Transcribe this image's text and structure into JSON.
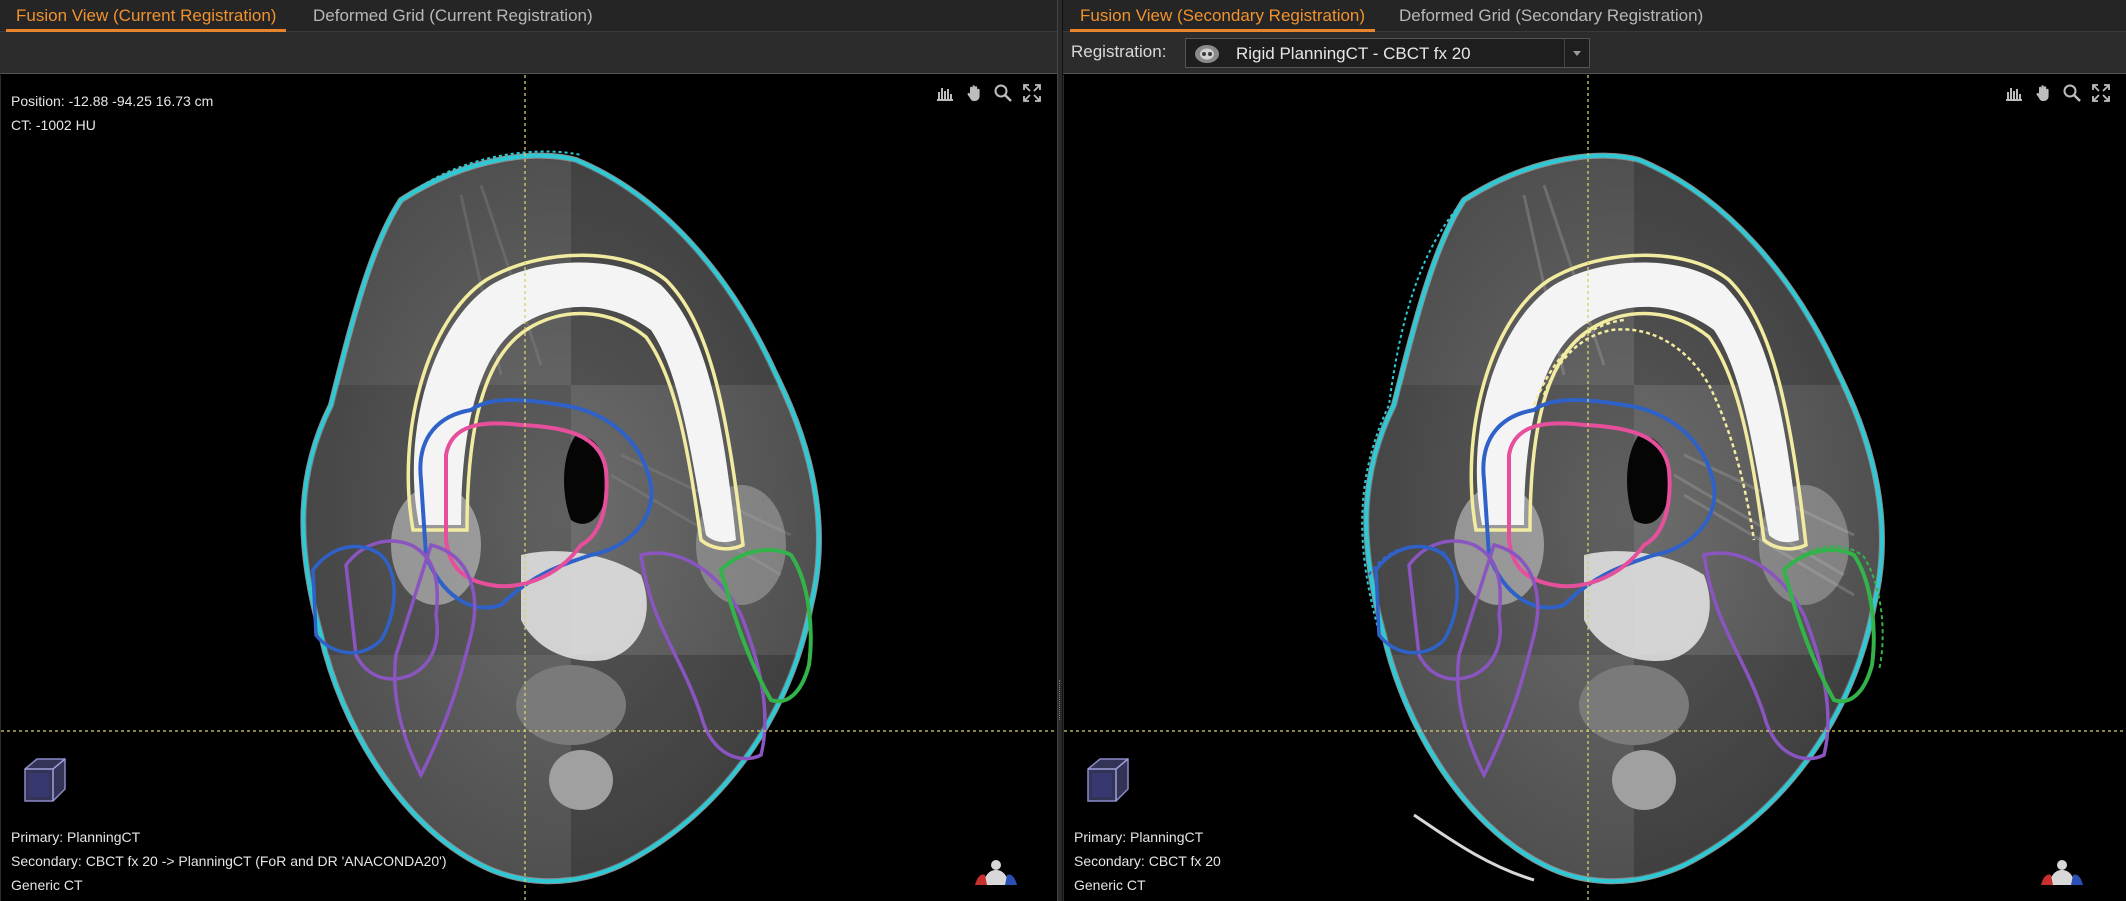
{
  "left": {
    "tabs": [
      {
        "label": "Fusion View (Current Registration)",
        "active": true
      },
      {
        "label": "Deformed Grid (Current Registration)",
        "active": false
      }
    ],
    "position_text": "Position: -12.88 -94.25 16.73 cm",
    "ct_value_text": "CT: -1002 HU",
    "primary_text": "Primary: PlanningCT",
    "secondary_text": "Secondary: CBCT fx 20 -> PlanningCT (FoR and DR 'ANACONDA20')",
    "image_type_text": "Generic CT"
  },
  "right": {
    "tabs": [
      {
        "label": "Fusion View (Secondary Registration)",
        "active": true
      },
      {
        "label": "Deformed Grid (Secondary Registration)",
        "active": false
      }
    ],
    "registration_label": "Registration:",
    "registration_value": "Rigid PlanningCT - CBCT fx 20",
    "primary_text": "Primary: PlanningCT",
    "secondary_text": "Secondary: CBCT fx 20",
    "image_type_text": "Generic CT"
  },
  "viewer_tools": [
    "histogram-icon",
    "pan-hand-icon",
    "zoom-icon",
    "fullscreen-icon"
  ],
  "colors": {
    "active_tab": "#f0922e",
    "external_contour": "#2ec9d4",
    "mandible_contour": "#f2eca0",
    "blue_contour": "#2f62c8",
    "pink_contour": "#e64f9c",
    "purple_contour": "#8a55c0",
    "green_contour": "#33b34a",
    "crosshair": "#d8cf6a"
  }
}
